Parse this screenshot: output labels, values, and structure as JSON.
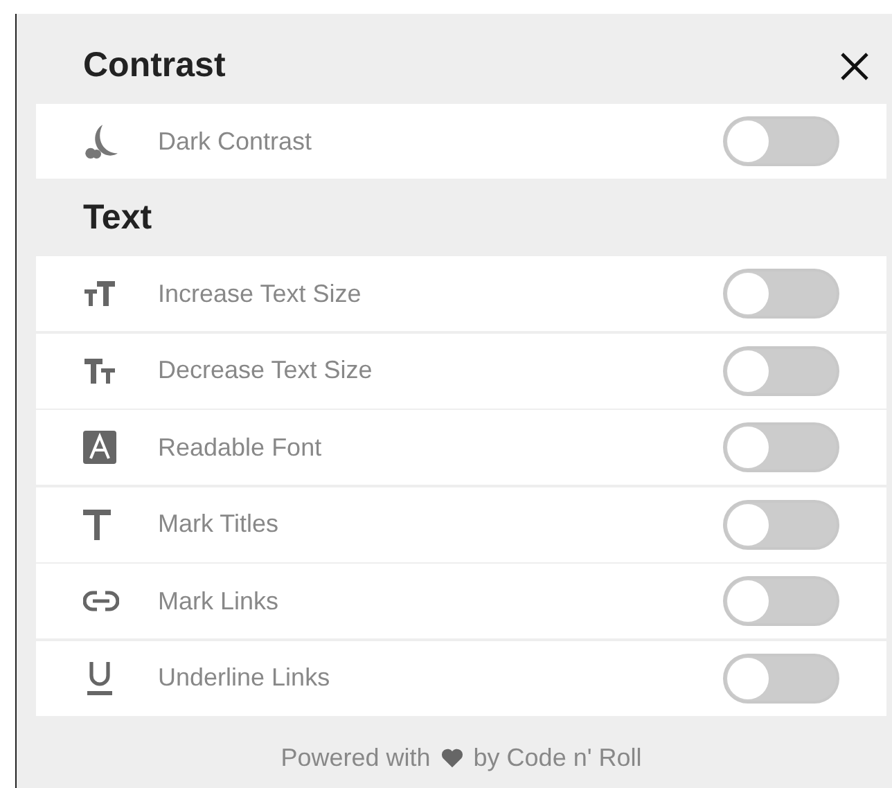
{
  "sections": [
    {
      "title": "Contrast",
      "items": [
        {
          "label": "Dark Contrast",
          "on": false
        }
      ]
    },
    {
      "title": "Text",
      "items": [
        {
          "label": "Increase Text Size",
          "on": false
        },
        {
          "label": "Decrease Text Size",
          "on": false
        },
        {
          "label": "Readable Font",
          "on": false
        },
        {
          "label": "Mark Titles",
          "on": false
        },
        {
          "label": "Mark Links",
          "on": false
        },
        {
          "label": "Underline Links",
          "on": false
        }
      ]
    }
  ],
  "footer": {
    "before": "Powered with",
    "after": "by Code n' Roll"
  }
}
